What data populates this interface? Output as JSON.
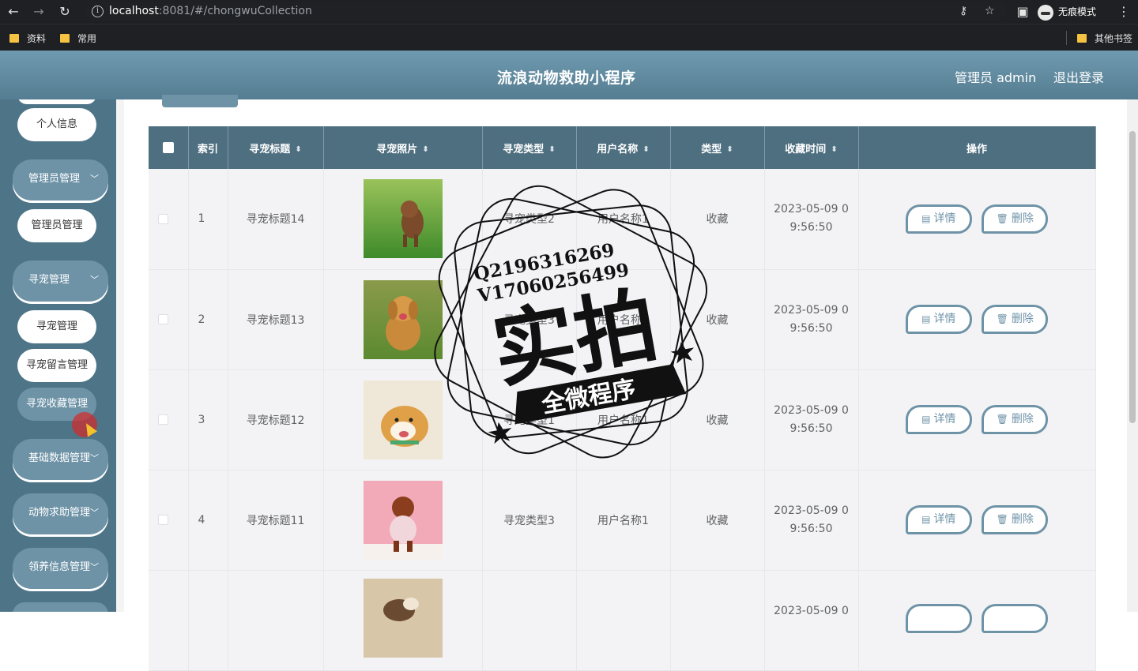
{
  "browser": {
    "url_host": "localhost",
    "url_port_path": ":8081/#/chongwuCollection",
    "incognito_label": "无痕模式",
    "bookmarks": [
      "资料",
      "常用"
    ],
    "other_bookmarks": "其他书签"
  },
  "header": {
    "title": "流浪动物救助小程序",
    "admin_label": "管理员 admin",
    "logout": "退出登录"
  },
  "sidebar": {
    "items": [
      {
        "label": "个人信息",
        "kind": "sub"
      },
      {
        "label": "管理员管理",
        "kind": "group"
      },
      {
        "label": "管理员管理",
        "kind": "sub"
      },
      {
        "label": "寻宠管理",
        "kind": "group"
      },
      {
        "label": "寻宠管理",
        "kind": "sub"
      },
      {
        "label": "寻宠留言管理",
        "kind": "sub"
      },
      {
        "label": "寻宠收藏管理",
        "kind": "sub",
        "active": true
      },
      {
        "label": "基础数据管理",
        "kind": "group"
      },
      {
        "label": "动物求助管理",
        "kind": "group"
      },
      {
        "label": "领养信息管理",
        "kind": "group"
      }
    ]
  },
  "table": {
    "headers": {
      "index": "索引",
      "title": "寻宠标题",
      "photo": "寻宠照片",
      "pet_type": "寻宠类型",
      "username": "用户名称",
      "type": "类型",
      "time": "收藏时间",
      "ops": "操作"
    },
    "rows": [
      {
        "index": "1",
        "title": "寻宠标题14",
        "pet_type": "寻宠类型2",
        "username": "用户名称1",
        "type": "收藏",
        "time_a": "2023-05-09 0",
        "time_b": "9:56:50"
      },
      {
        "index": "2",
        "title": "寻宠标题13",
        "pet_type": "寻宠类型3",
        "username": "用户名称1",
        "type": "收藏",
        "time_a": "2023-05-09 0",
        "time_b": "9:56:50"
      },
      {
        "index": "3",
        "title": "寻宠标题12",
        "pet_type": "寻宠类型1",
        "username": "用户名称1",
        "type": "收藏",
        "time_a": "2023-05-09 0",
        "time_b": "9:56:50"
      },
      {
        "index": "4",
        "title": "寻宠标题11",
        "pet_type": "寻宠类型3",
        "username": "用户名称1",
        "type": "收藏",
        "time_a": "2023-05-09 0",
        "time_b": "9:56:50"
      },
      {
        "index": "",
        "title": "",
        "pet_type": "",
        "username": "",
        "type": "",
        "time_a": "2023-05-09 0",
        "time_b": ""
      }
    ],
    "detail_label": "详情",
    "delete_label": "删除"
  },
  "watermark": {
    "qq": "Q2196316269",
    "vx": "V17060256499",
    "big": "实拍",
    "banner": "全微程序"
  },
  "colors": {
    "header": "#6f9aaf",
    "sidebar": "#4e7488",
    "accent": "#6e93a7",
    "table_head": "#4e6f80"
  }
}
